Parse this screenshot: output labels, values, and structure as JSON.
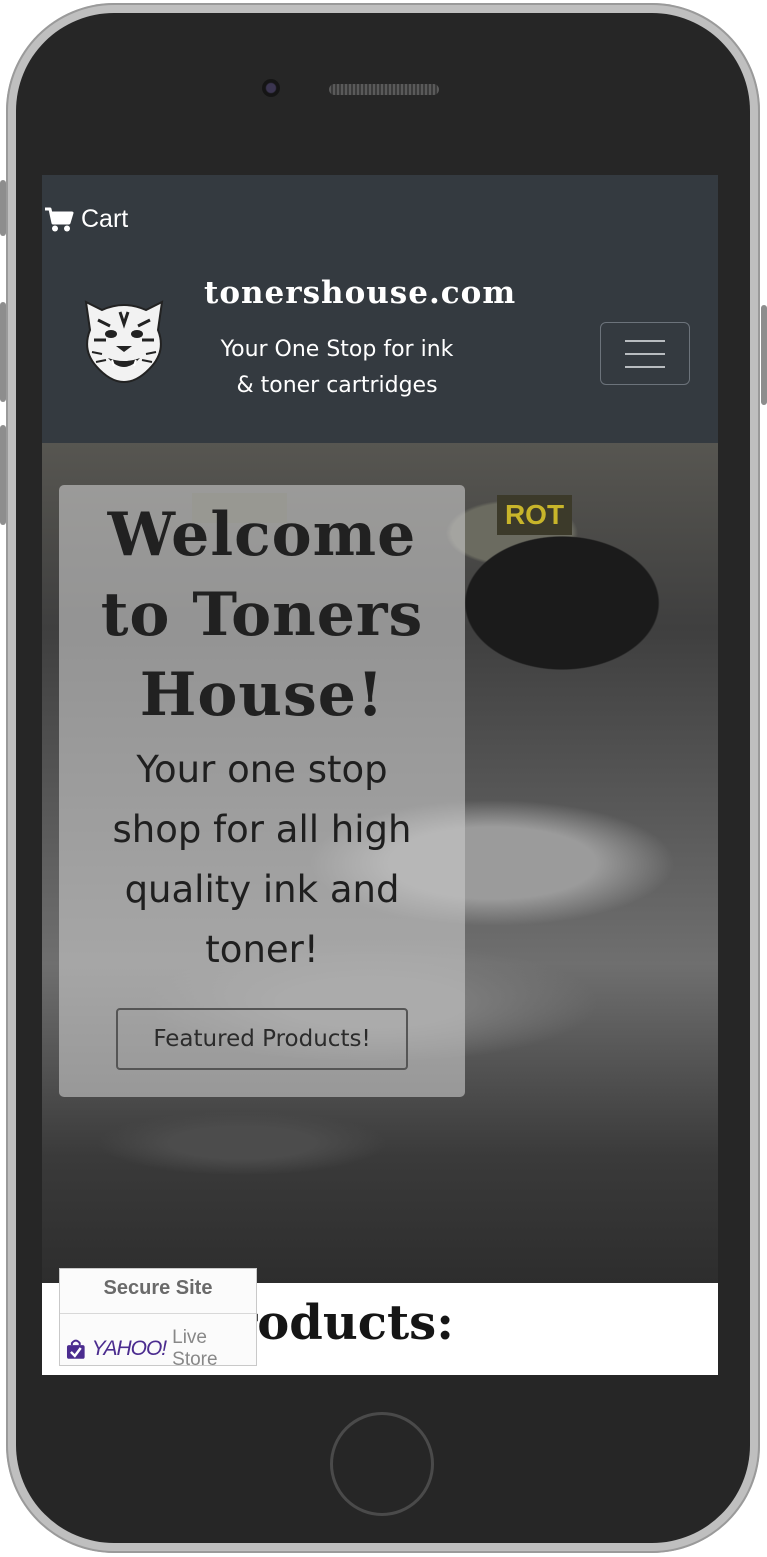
{
  "header": {
    "cart_label": "Cart",
    "brand_name": "tonershouse.com",
    "tagline_line1": "Your One Stop for ink",
    "tagline_line2": "& toner cartridges"
  },
  "hero": {
    "title_line1": "Welcome",
    "title_line2": "to Toners",
    "title_line3": "House!",
    "text_line1": "Your one stop",
    "text_line2": "shop for all high",
    "text_line3": "quality ink and",
    "text_line4": "toner!",
    "button_label": "Featured Products!",
    "photo_label_right": "ROT"
  },
  "products": {
    "heading_visible": "roducts:"
  },
  "secure_badge": {
    "title": "Secure Site",
    "brand": "YAHOO!",
    "store": "Live Store"
  },
  "colors": {
    "navbar": "#343a40",
    "yahoo_purple": "#4b2c8f"
  },
  "icons": {
    "cart": "cart-icon",
    "menu": "hamburger-menu-icon",
    "logo": "tiger-logo-icon",
    "badge": "shopping-bag-check-icon"
  }
}
